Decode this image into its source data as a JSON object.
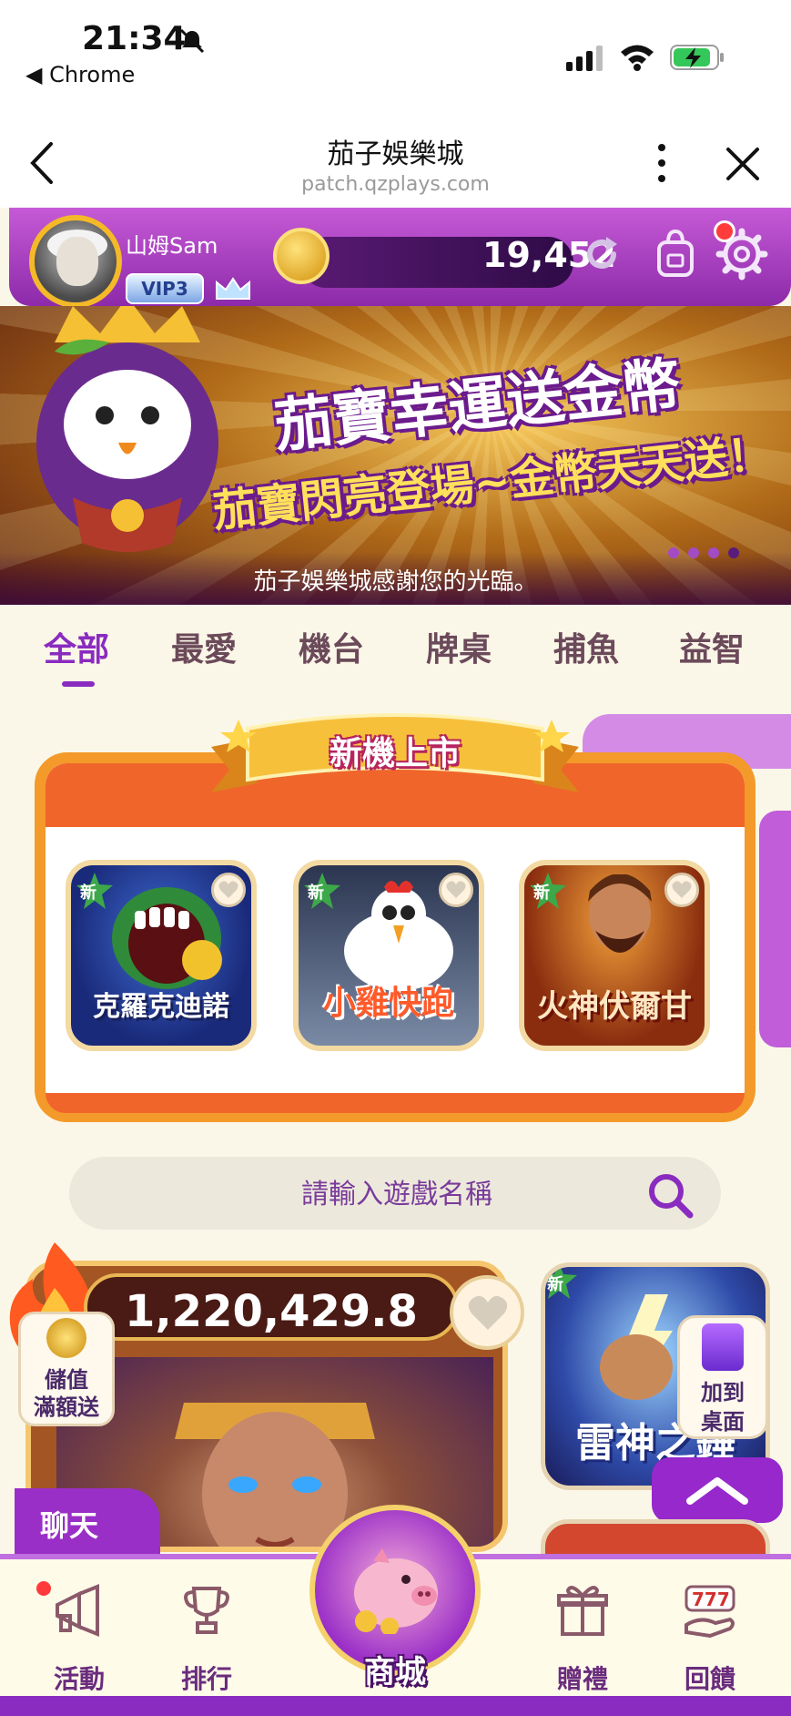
{
  "status_bar": {
    "time": "21:34",
    "back_app": "◀ Chrome",
    "icons": [
      "bell-slash-icon",
      "signal-icon",
      "wifi-icon",
      "battery-charging-icon"
    ]
  },
  "browser": {
    "title": "茄子娛樂城",
    "url": "patch.qzplays.com"
  },
  "user": {
    "name": "山姆Sam",
    "vip": "VIP3",
    "balance": "19,452"
  },
  "banner": {
    "line1": "茄寶幸運送金幣",
    "line2": "茄寶閃亮登場~金幣天天送！",
    "marquee": "茄子娛樂城感謝您的光臨。"
  },
  "tabs": [
    "全部",
    "最愛",
    "機台",
    "牌桌",
    "捕魚",
    "益智"
  ],
  "active_tab": "全部",
  "new_machines": {
    "title": "新機上市",
    "badge": "新",
    "games": [
      {
        "title": "克羅克迪諾"
      },
      {
        "title": "小雞快跑"
      },
      {
        "title": "火神伏爾甘"
      }
    ]
  },
  "search": {
    "placeholder": "請輸入遊戲名稱"
  },
  "hot": {
    "jackpot": "1,220,429.8",
    "deposit_line1": "儲值",
    "deposit_line2": "滿額送"
  },
  "side_game": {
    "title": "雷神之錘",
    "badge": "新",
    "add_line1": "加到",
    "add_line2": "桌面"
  },
  "chat": {
    "label": "聊天"
  },
  "bottom_nav": {
    "event": "活動",
    "rank": "排行",
    "mall": "商城",
    "gift": "贈禮",
    "rebate": "回饋"
  },
  "colors": {
    "primary_purple": "#8a2bbf",
    "accent_orange": "#f0652a",
    "gold": "#f4b928",
    "background": "#fbf7e8"
  }
}
